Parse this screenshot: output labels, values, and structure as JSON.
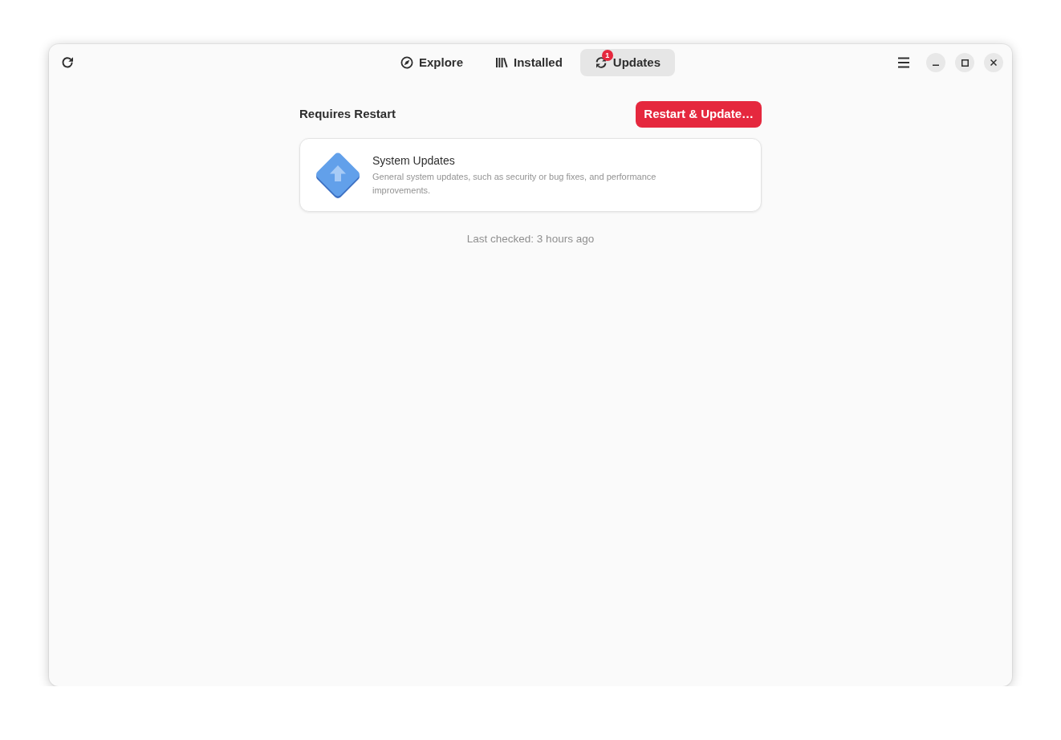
{
  "header": {
    "tabs": [
      {
        "label": "Explore",
        "selected": false
      },
      {
        "label": "Installed",
        "selected": false
      },
      {
        "label": "Updates",
        "selected": true,
        "badge": "1"
      }
    ]
  },
  "section": {
    "heading": "Requires Restart",
    "action": "Restart & Update…"
  },
  "updates": [
    {
      "title": "System Updates",
      "description": "General system updates, such as security or bug fixes, and performance improvements."
    }
  ],
  "status": "Last checked: 3 hours ago"
}
